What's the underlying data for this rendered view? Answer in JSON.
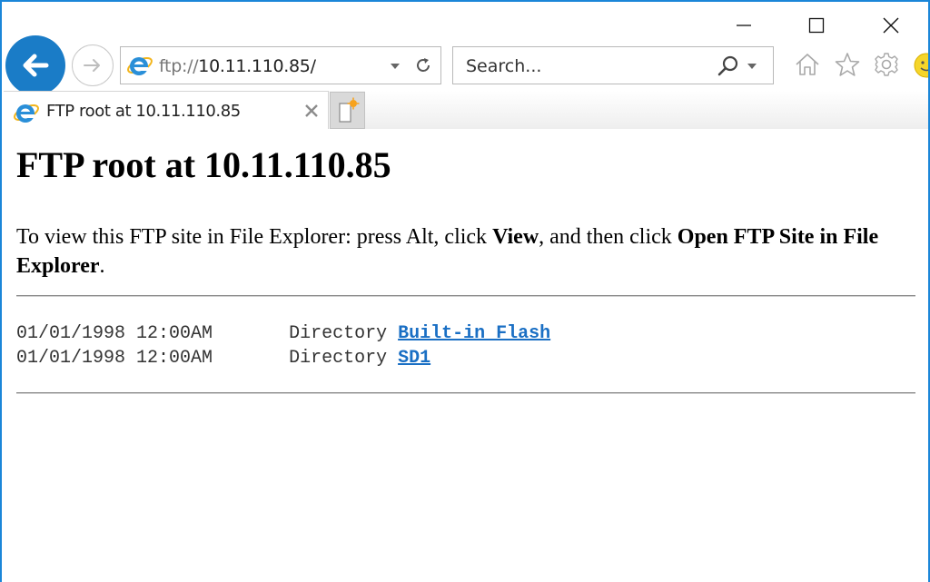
{
  "window": {
    "caption_buttons": {
      "minimize": "minimize-icon",
      "maximize": "maximize-icon",
      "close": "close-icon"
    }
  },
  "navigation": {
    "back_icon": "back-arrow-icon",
    "forward_icon": "forward-arrow-icon",
    "address": {
      "protocol": "ftp://",
      "host": "10.11.110.85/"
    },
    "search": {
      "placeholder": "Search..."
    },
    "toolbar_icons": [
      "home-icon",
      "favorites-star-icon",
      "settings-gear-icon",
      "feedback-smiley-icon"
    ]
  },
  "tabs": [
    {
      "title": "FTP root at 10.11.110.85",
      "active": true
    }
  ],
  "page": {
    "title": "FTP root at 10.11.110.85",
    "instructions": {
      "part1": "To view this FTP site in File Explorer: press Alt, click ",
      "bold1": "View",
      "part2": ", and then click ",
      "bold2": "Open FTP Site in File Explorer",
      "part3": "."
    },
    "listing": [
      {
        "date": "01/01/1998 12:00AM",
        "type": "Directory",
        "name": "Built-in Flash"
      },
      {
        "date": "01/01/1998 12:00AM",
        "type": "Directory",
        "name": "SD1"
      }
    ]
  },
  "colors": {
    "accent": "#1a86d8",
    "back_button": "#1a7cc7",
    "link": "#1a6fc4"
  }
}
